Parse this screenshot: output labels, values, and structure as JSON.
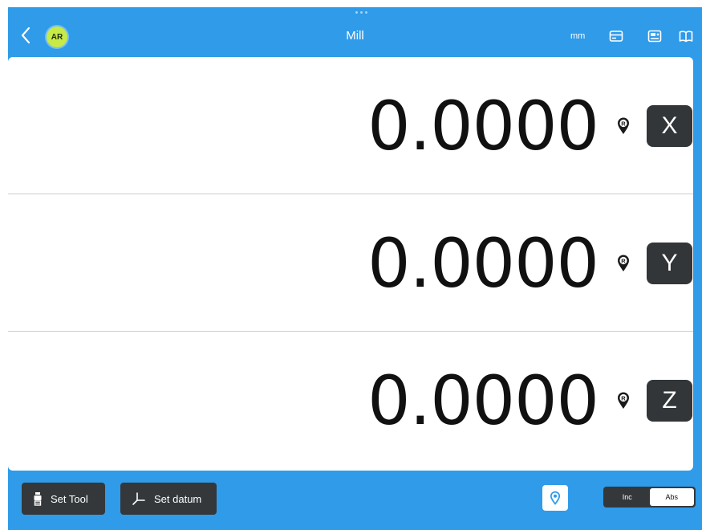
{
  "header": {
    "title": "Mill",
    "user_initials": "AR",
    "unit": "mm",
    "icons": [
      "card-icon",
      "calculator-card-icon",
      "manual-book-icon"
    ]
  },
  "axes": [
    {
      "label": "X",
      "value": "0.0000"
    },
    {
      "label": "Y",
      "value": "0.0000"
    },
    {
      "label": "Z",
      "value": "0.0000"
    }
  ],
  "footer": {
    "set_tool_label": "Set Tool",
    "set_datum_label": "Set datum",
    "mode_toggle": {
      "options": [
        "Inc",
        "Abs"
      ],
      "selected": "Abs"
    }
  },
  "colors": {
    "accent": "#2f9be9",
    "avatar": "#c7ea47",
    "key_background": "#333638"
  }
}
